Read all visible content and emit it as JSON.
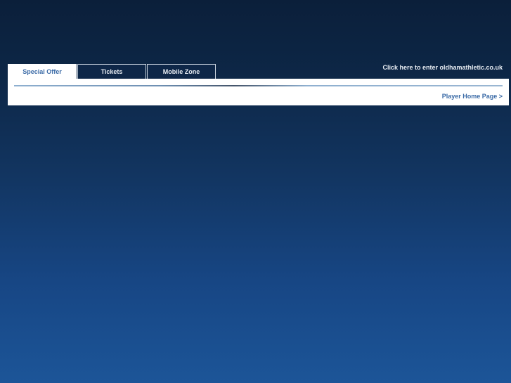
{
  "tabs": [
    {
      "label": "Special Offer",
      "active": true
    },
    {
      "label": "Tickets",
      "active": false
    },
    {
      "label": "Mobile Zone",
      "active": false
    }
  ],
  "header": {
    "enter_link": "Click here to enter oldhamathletic.co.uk"
  },
  "panel": {
    "player_link": "Player Home Page >"
  }
}
